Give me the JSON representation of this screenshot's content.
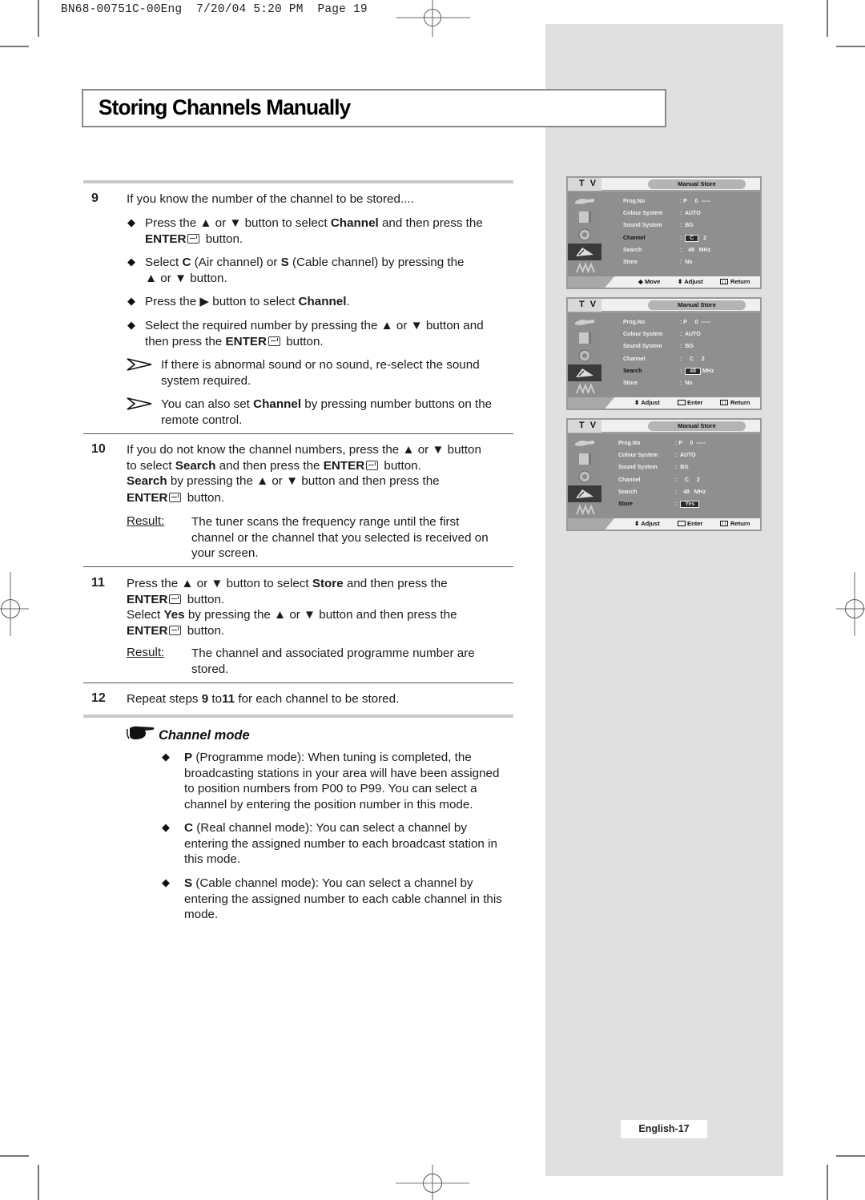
{
  "print_slug": "BN68-00751C-00Eng  7/20/04 5:20 PM  Page 19",
  "title": "Storing Channels Manually",
  "steps": {
    "s9": {
      "number": "9",
      "intro": "If you know the number of the channel to be stored....",
      "bullets": [
        {
          "pre": "Press the ▲ or ▼ button to select ",
          "bold": "Channel",
          "post": " and then press the",
          "line2_bold": "ENTER",
          "line2_post": " button."
        },
        {
          "pre": "Select ",
          "b1": "C",
          "mid": " (Air channel) or ",
          "b2": "S",
          "post": " (Cable channel) by pressing the",
          "line2": "▲ or ▼ button."
        },
        {
          "pre": "Press the ▶ button to select ",
          "bold": "Channel",
          "post": "."
        },
        {
          "pre": "Select the required number by pressing the ▲ or ▼ button and",
          "line2_pre": "then press the ",
          "line2_bold": "ENTER",
          "line2_post": " button."
        }
      ],
      "notes": [
        {
          "line1": "If there is abnormal sound or no sound, re-select the sound",
          "line2": "system required."
        },
        {
          "pre": "You can also set ",
          "bold": "Channel",
          "post": " by pressing number buttons on the",
          "line2": "remote control."
        }
      ]
    },
    "s10": {
      "number": "10",
      "line1": "If you do not know the channel numbers, press the ▲ or ▼ button",
      "line2_pre": "to select ",
      "line2_bold": "Search",
      "line2_mid": " and then press the ",
      "line2_bold2": "ENTER",
      "line2_post": " button.",
      "line3_bold": "Search",
      "line3_post": " by pressing the ▲ or ▼ button and then press the",
      "line4_bold": "ENTER",
      "line4_post": " button.",
      "result_label": "Result:",
      "result_lines": [
        "The tuner scans the frequency range until the first",
        "channel or the channel that you selected is received on",
        "your screen."
      ]
    },
    "s11": {
      "number": "11",
      "line1_pre": "Press the ▲ or ▼ button to select ",
      "line1_bold": "Store",
      "line1_post": " and then press the",
      "line2_bold": "ENTER",
      "line2_post": " button.",
      "line3_pre": "Select ",
      "line3_bold": "Yes",
      "line3_post": " by pressing the ▲ or ▼ button and then press the",
      "line4_bold": "ENTER",
      "line4_post": " button.",
      "result_label": "Result:",
      "result_lines": [
        "The channel and associated programme number are",
        "stored."
      ]
    },
    "s12": {
      "number": "12",
      "pre": "Repeat steps ",
      "b1": "9",
      "mid": " to",
      "b2": "11",
      "post": " for each channel to be stored."
    }
  },
  "channel_mode": {
    "heading": "Channel mode",
    "items": [
      {
        "letter": "P",
        "lines": [
          " (Programme mode): When tuning is completed, the",
          "broadcasting stations in your area will have been assigned",
          "to position numbers from P00 to P99. You can select a",
          "channel by entering the position number in this mode."
        ]
      },
      {
        "letter": "C",
        "lines": [
          " (Real channel mode): You can select a channel by",
          "entering the assigned number to each broadcast station in",
          "this mode."
        ]
      },
      {
        "letter": "S",
        "lines": [
          " (Cable channel mode): You can select a channel by",
          "entering the assigned number to each cable channel in this",
          "mode."
        ]
      }
    ]
  },
  "osd_screens": [
    {
      "tv_label": "T V",
      "menu_title": "Manual Store",
      "rows": [
        {
          "label": "Prog.No",
          "value": ": P     0  -----"
        },
        {
          "label": "Colour System",
          "value": ":  AUTO"
        },
        {
          "label": "Sound System",
          "value": ":  BG"
        },
        {
          "label": "Channel",
          "value_pre": ":  ",
          "value_box": "C",
          "value_post": "   2",
          "highlight": true
        },
        {
          "label": "Search",
          "value": ":    48   MHz"
        },
        {
          "label": "Store",
          "value": ":  No"
        }
      ],
      "hints": [
        "◆ Move",
        "⬍ Adjust",
        "Return"
      ]
    },
    {
      "tv_label": "T V",
      "menu_title": "Manual Store",
      "rows": [
        {
          "label": "Prog.No",
          "value": ": P     0  -----"
        },
        {
          "label": "Colour System",
          "value": ":  AUTO"
        },
        {
          "label": "Sound System",
          "value": ":  BG"
        },
        {
          "label": "Channel",
          "value": ":     C     2"
        },
        {
          "label": "Search",
          "value_pre": ":  ",
          "value_box": "48",
          "value_post": " MHz",
          "highlight": true
        },
        {
          "label": "Store",
          "value": ":  No"
        }
      ],
      "hints": [
        "⬍ Adjust",
        "Enter",
        "Return"
      ]
    },
    {
      "tv_label": "T V",
      "menu_title": "Manual Store",
      "rows": [
        {
          "label": "Prog.No",
          "value": ": P     0  -----"
        },
        {
          "label": "Colour System",
          "value": ":  AUTO"
        },
        {
          "label": "Sound System",
          "value": ":  BG"
        },
        {
          "label": "Channel",
          "value": ":     C     2"
        },
        {
          "label": "Search",
          "value": ":    48   MHz"
        },
        {
          "label": "Store",
          "value_pre": ":  ",
          "value_box": "Yes",
          "value_post": "",
          "highlight": true
        }
      ],
      "hints": [
        "⬍ Adjust",
        "Enter",
        "Return"
      ]
    }
  ],
  "page_number": "English-17",
  "colors": {
    "side_panel": "#e0e0e0",
    "osd_body": "#8f8f8f",
    "rule_gray": "#c8c8c8"
  }
}
